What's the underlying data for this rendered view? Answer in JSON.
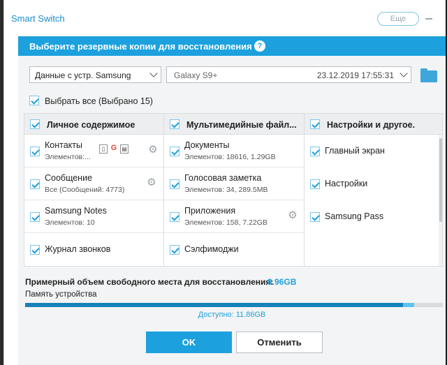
{
  "window": {
    "title": "Smart Switch",
    "more_label": "Еще"
  },
  "dialog": {
    "title": "Выберите резервные копии для восстановления",
    "help_symbol": "?",
    "source_select": "Данные с устр. Samsung",
    "backup": {
      "device": "Galaxy S9+",
      "date": "23.12.2019 17:55:31"
    },
    "select_all_label": "Выбрать все (Выбрано 15)",
    "columns": [
      {
        "header": "Личное содержимое",
        "items": [
          {
            "name": "Контакты",
            "sub": "Элементов:..."
          },
          {
            "name": "Сообщение",
            "sub": "Все (Сообщений: 4773)"
          },
          {
            "name": "Samsung Notes",
            "sub": "Элементов: 10"
          },
          {
            "name": "Журнал звонков",
            "sub": ""
          }
        ]
      },
      {
        "header": "Мультимедийные файл...",
        "items": [
          {
            "name": "Документы",
            "sub": "Элементов: 18616, 1.29GB"
          },
          {
            "name": "Голосовая заметка",
            "sub": "Элементов: 34, 289.5MB"
          },
          {
            "name": "Приложения",
            "sub": "Элементов: 158, 7.22GB"
          },
          {
            "name": "Сэлфимоджи",
            "sub": ""
          }
        ]
      },
      {
        "header": "Настройки и другое.",
        "items": [
          {
            "name": "Главный экран",
            "sub": ""
          },
          {
            "name": "Настройки",
            "sub": ""
          },
          {
            "name": "Samsung Pass",
            "sub": ""
          }
        ]
      }
    ],
    "contact_icons": [
      "sim-card",
      "google-g",
      "sd-card"
    ],
    "contact_icon_glyphs": [
      "▯",
      "G",
      "▤"
    ],
    "space_label": "Примерный объем свободного места для восстановления:",
    "space_value": "8.96GB",
    "memory_label": "Память устройства",
    "memory_used_fraction": 0.905,
    "memory_restore_fraction": 0.026,
    "available_label": "Доступно: 11.86GB",
    "ok_label": "OK",
    "cancel_label": "Отменить"
  },
  "colors": {
    "accent": "#1ca1de",
    "header_bar": "#1ca1de",
    "progress_used": "#1582b9",
    "progress_restore": "#5fc3ef"
  }
}
